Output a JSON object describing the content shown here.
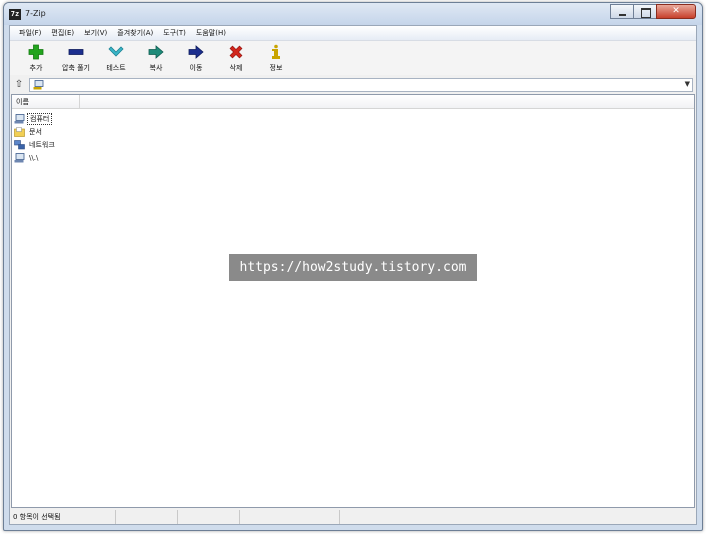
{
  "window": {
    "title": "7-Zip",
    "app_icon_text": "7z"
  },
  "menu": [
    {
      "label": "파일(F)"
    },
    {
      "label": "편집(E)"
    },
    {
      "label": "보기(V)"
    },
    {
      "label": "즐겨찾기(A)"
    },
    {
      "label": "도구(T)"
    },
    {
      "label": "도움말(H)"
    }
  ],
  "toolbar": [
    {
      "label": "추가",
      "icon": "add-icon",
      "color": "#22a41d"
    },
    {
      "label": "압축 풀기",
      "icon": "extract-icon",
      "color": "#1c2f8f"
    },
    {
      "label": "테스트",
      "icon": "test-icon",
      "color": "#3ab6c8"
    },
    {
      "label": "복사",
      "icon": "copy-icon",
      "color": "#1e8c7a"
    },
    {
      "label": "이동",
      "icon": "move-icon",
      "color": "#1c2f8f"
    },
    {
      "label": "삭제",
      "icon": "delete-icon",
      "color": "#d2261c"
    },
    {
      "label": "정보",
      "icon": "info-icon",
      "color": "#c9a400"
    }
  ],
  "address": {
    "value": ""
  },
  "list": {
    "columns": [
      {
        "label": "이름"
      }
    ],
    "items": [
      {
        "label": "컴퓨터",
        "icon": "computer-icon"
      },
      {
        "label": "문서",
        "icon": "documents-icon"
      },
      {
        "label": "네트워크",
        "icon": "network-icon"
      },
      {
        "label": "\\\\.\\",
        "icon": "device-icon"
      }
    ]
  },
  "status": {
    "selection": "0 항목이 선택됨"
  },
  "watermark": {
    "text": "https://how2study.tistory.com"
  }
}
